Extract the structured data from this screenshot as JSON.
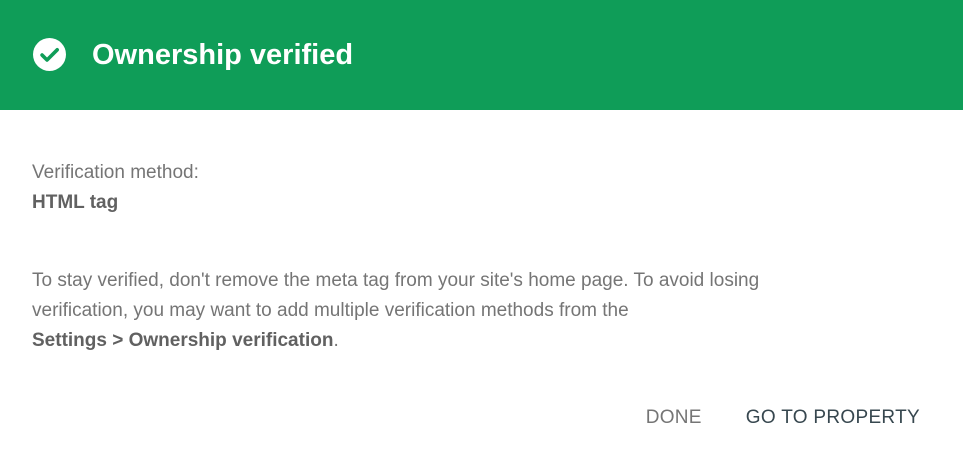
{
  "header": {
    "title": "Ownership verified",
    "icon": "check-circle-icon",
    "background_color": "#0f9d58"
  },
  "verification": {
    "method_label": "Verification method:",
    "method_value": "HTML tag"
  },
  "info": {
    "line1": "To stay verified, don't remove the meta tag from your site's home page. To avoid losing",
    "line2": "verification, you may want to add multiple verification methods from the",
    "settings_link": "Settings > Ownership verification",
    "trailing": "."
  },
  "actions": {
    "done_label": "DONE",
    "go_label": "GO TO PROPERTY"
  }
}
